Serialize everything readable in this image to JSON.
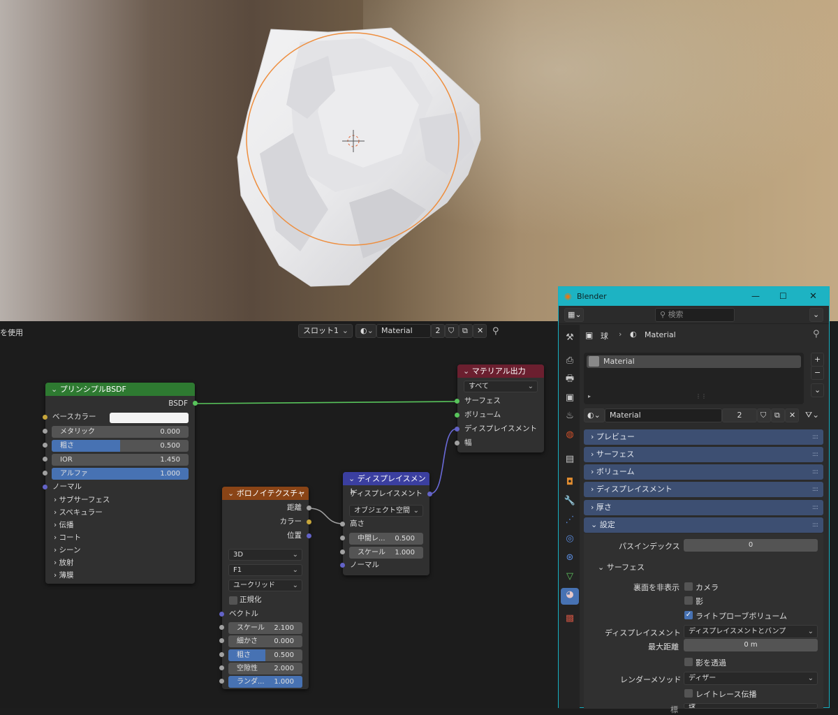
{
  "editor_header": {
    "use_label_partial": "を使用",
    "slot": "スロット1",
    "material_name": "Material",
    "user_count": "2"
  },
  "nodes": {
    "bsdf": {
      "title": "プリンシプルBSDF",
      "output": "BSDF",
      "base_color": "ベースカラー",
      "metallic": {
        "label": "メタリック",
        "value": "0.000"
      },
      "roughness": {
        "label": "粗さ",
        "value": "0.500",
        "fill": 0.5
      },
      "ior": {
        "label": "IOR",
        "value": "1.450"
      },
      "alpha": {
        "label": "アルファ",
        "value": "1.000",
        "fill": 1.0
      },
      "normal": "ノーマル",
      "panels": [
        "サブサーフェス",
        "スペキュラー",
        "伝播",
        "コート",
        "シーン",
        "放射",
        "薄膜"
      ]
    },
    "output": {
      "title": "マテリアル出力",
      "target": "すべて",
      "surface": "サーフェス",
      "volume": "ボリューム",
      "displacement": "ディスプレイスメント",
      "width": "幅"
    },
    "displacement": {
      "title": "ディスプレイスメント",
      "output": "ディスプレイスメント",
      "space": "オブジェクト空間",
      "height": "高さ",
      "midlevel": {
        "label": "中間レ...",
        "value": "0.500"
      },
      "scale": {
        "label": "スケール",
        "value": "1.000"
      },
      "normal": "ノーマル"
    },
    "voronoi": {
      "title": "ボロノイテクスチャ",
      "out_distance": "距離",
      "out_color": "カラー",
      "out_position": "位置",
      "dimensions": "3D",
      "feature": "F1",
      "metric": "ユークリッド",
      "normalize": "正規化",
      "vector": "ベクトル",
      "scale": {
        "label": "スケール",
        "value": "2.100"
      },
      "detail": {
        "label": "細かさ",
        "value": "0.000"
      },
      "roughness": {
        "label": "粗さ",
        "value": "0.500",
        "fill": 0.5
      },
      "lacunarity": {
        "label": "空隙性",
        "value": "2.000"
      },
      "randomness": {
        "label": "ランダ...",
        "value": "1.000",
        "fill": 1.0
      }
    }
  },
  "window": {
    "title": "Blender",
    "search_placeholder": "検索",
    "breadcrumb_object": "球",
    "breadcrumb_material": "Material",
    "slot_item": "Material",
    "material_name": "Material",
    "user_count": "2",
    "panels": [
      "プレビュー",
      "サーフェス",
      "ボリューム",
      "ディスプレイスメント",
      "厚さ",
      "設定"
    ],
    "pass_index_label": "パスインデックス",
    "pass_index_value": "0",
    "surface_sub": "サーフェス",
    "backface_label": "裏面を非表示",
    "camera": "カメラ",
    "shadow": "影",
    "lightprobe": "ライトプローブボリューム",
    "displacement_label": "ディスプレイスメント",
    "displacement_value": "ディスプレイスメントとバンプ",
    "max_dist_label": "最大距離",
    "max_dist_value": "0 m",
    "transparent_shadow": "影を透過",
    "render_method_label": "レンダーメソッド",
    "render_method_value": "ディザー",
    "raytrace": "レイトレース伝播",
    "cut_label": "標",
    "cut_value": "球"
  },
  "colors": {
    "accent_blue": "#4772b3",
    "bsdf_header": "#2e7a31",
    "output_header": "#6b1f2f",
    "displacement_header": "#3b3fa0",
    "texture_header": "#8a4416",
    "window_title": "#1db3c3",
    "panel_header": "#3d4f72"
  }
}
